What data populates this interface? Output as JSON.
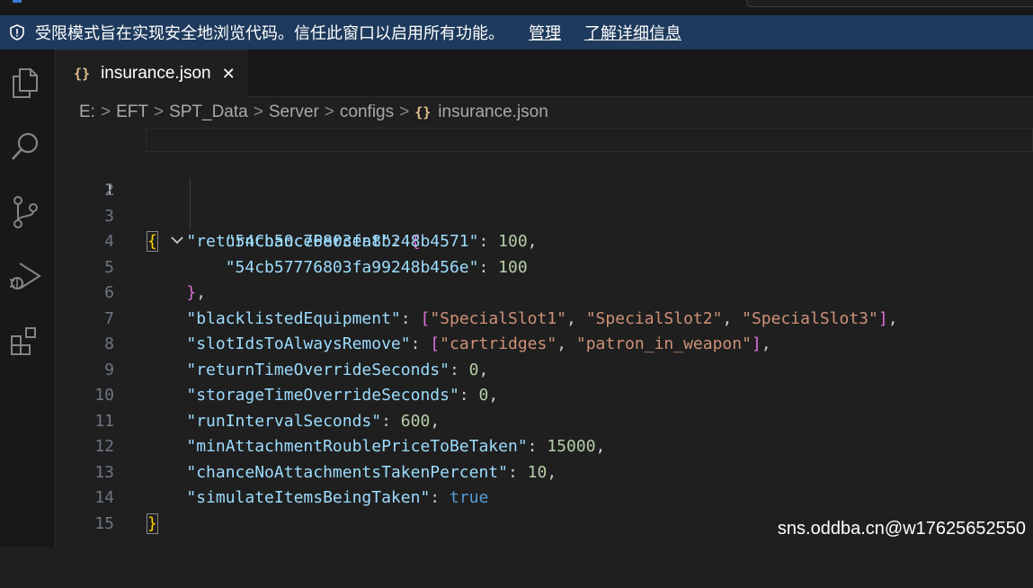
{
  "banner": {
    "message": "受限模式旨在实现安全地浏览代码。信任此窗口以启用所有功能。",
    "manage_link": "管理",
    "learn_more_link": "了解详细信息"
  },
  "activity_bar": [
    "explorer-icon",
    "search-icon",
    "source-control-icon",
    "run-debug-icon",
    "extensions-icon"
  ],
  "tab": {
    "icon_glyph": "{}",
    "filename": "insurance.json",
    "close_glyph": "✕"
  },
  "breadcrumb": {
    "items": [
      "E:",
      "EFT",
      "SPT_Data",
      "Server",
      "configs"
    ],
    "separator": ">",
    "current_icon": "{}",
    "current": "insurance.json"
  },
  "editor": {
    "lines": [
      {
        "num": "1"
      },
      {
        "num": "2"
      },
      {
        "num": "3"
      },
      {
        "num": "4"
      },
      {
        "num": "5"
      },
      {
        "num": "6"
      },
      {
        "num": "7"
      },
      {
        "num": "8"
      },
      {
        "num": "9"
      },
      {
        "num": "10"
      },
      {
        "num": "11"
      },
      {
        "num": "12"
      },
      {
        "num": "13"
      },
      {
        "num": "14"
      },
      {
        "num": "15"
      }
    ],
    "tokens": {
      "open_brace": "{",
      "close_brace": "}",
      "returnChancePercent": "\"returnChancePercent\"",
      "key1": "\"54cb50c76803fa8b248b4571\"",
      "val1": "100",
      "key2": "\"54cb57776803fa99248b456e\"",
      "val2": "100",
      "blacklistedEquipment": "\"blacklistedEquipment\"",
      "slot1": "\"SpecialSlot1\"",
      "slot2": "\"SpecialSlot2\"",
      "slot3": "\"SpecialSlot3\"",
      "slotIdsToAlwaysRemove": "\"slotIdsToAlwaysRemove\"",
      "cartridges": "\"cartridges\"",
      "patron": "\"patron_in_weapon\"",
      "returnTimeOverrideSeconds": "\"returnTimeOverrideSeconds\"",
      "returnTimeVal": "0",
      "storageTimeOverrideSeconds": "\"storageTimeOverrideSeconds\"",
      "storageTimeVal": "0",
      "runIntervalSeconds": "\"runIntervalSeconds\"",
      "runIntervalVal": "600",
      "minAttachment": "\"minAttachmentRoublePriceToBeTaken\"",
      "minAttachmentVal": "15000",
      "chanceNoAttachments": "\"chanceNoAttachmentsTakenPercent\"",
      "chanceNoAttachmentsVal": "10",
      "simulateItems": "\"simulateItemsBeingTaken\"",
      "simulateItemsVal": "true"
    }
  },
  "watermark": "sns.oddba.cn@w17625652550",
  "colors": {
    "banner_bg": "#1e3a5c",
    "editor_bg": "#1f1f1f",
    "json_key": "#9cdcfe",
    "json_string": "#ce9178",
    "json_number": "#b5cea8",
    "json_boolean": "#569cd6"
  }
}
